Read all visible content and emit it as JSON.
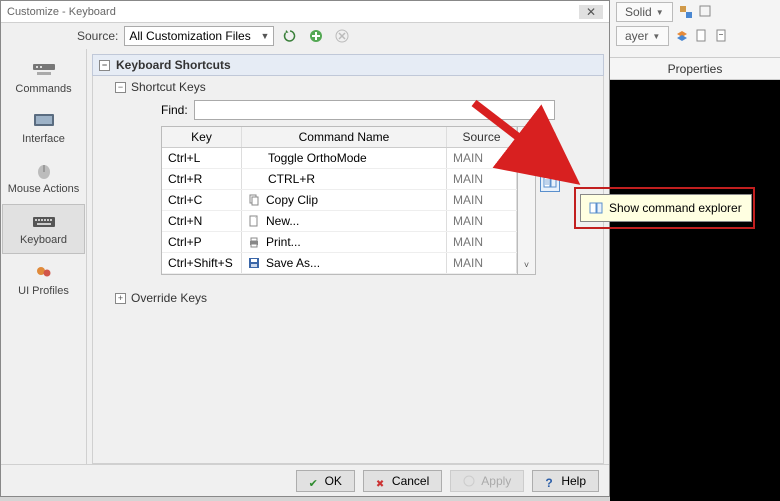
{
  "window": {
    "title": "Customize - Keyboard",
    "close": "✕"
  },
  "source": {
    "label": "Source:",
    "value": "All Customization Files"
  },
  "sidebar": {
    "items": [
      {
        "label": "Commands",
        "icon": "commands-icon"
      },
      {
        "label": "Interface",
        "icon": "interface-icon"
      },
      {
        "label": "Mouse Actions",
        "icon": "mouse-icon"
      },
      {
        "label": "Keyboard",
        "icon": "keyboard-icon"
      },
      {
        "label": "UI Profiles",
        "icon": "profiles-icon"
      }
    ]
  },
  "section": {
    "heading": "Keyboard Shortcuts",
    "node_shortcut": "Shortcut Keys",
    "node_override": "Override Keys"
  },
  "find": {
    "label": "Find:",
    "value": ""
  },
  "table": {
    "headers": {
      "key": "Key",
      "cmd": "Command Name",
      "src": "Source"
    },
    "rows": [
      {
        "key": "Ctrl+L",
        "cmd": "Toggle OrthoMode",
        "src": "MAIN",
        "icon": ""
      },
      {
        "key": "Ctrl+R",
        "cmd": "CTRL+R",
        "src": "MAIN",
        "icon": ""
      },
      {
        "key": "Ctrl+C",
        "cmd": "Copy Clip",
        "src": "MAIN",
        "icon": "copy"
      },
      {
        "key": "Ctrl+N",
        "cmd": "New...",
        "src": "MAIN",
        "icon": "new"
      },
      {
        "key": "Ctrl+P",
        "cmd": "Print...",
        "src": "MAIN",
        "icon": "print"
      },
      {
        "key": "Ctrl+Shift+S",
        "cmd": "Save As...",
        "src": "MAIN",
        "icon": "save"
      }
    ]
  },
  "tooltip": {
    "text": "Show command explorer"
  },
  "buttons": {
    "ok": "OK",
    "cancel": "Cancel",
    "apply": "Apply",
    "help": "Help"
  },
  "right": {
    "solid": "Solid",
    "ayer": "ayer",
    "properties": "Properties"
  }
}
